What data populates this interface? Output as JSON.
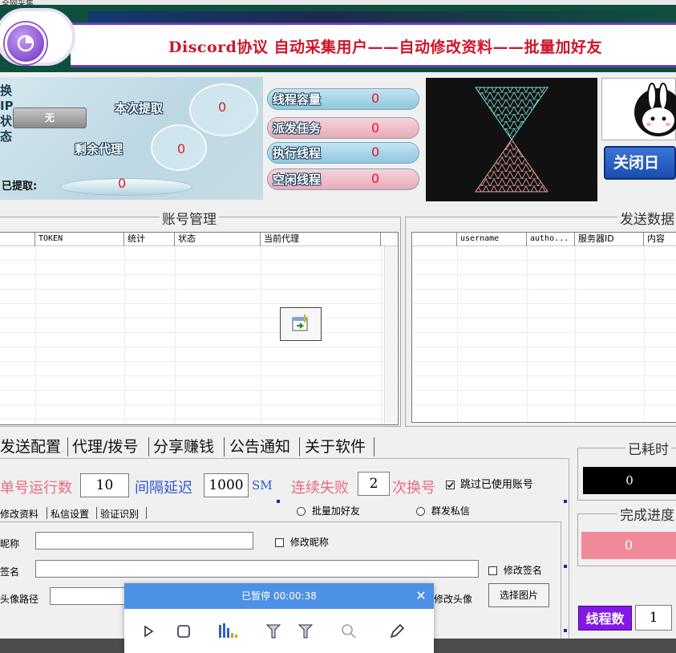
{
  "window": {
    "title": "全网采集"
  },
  "banner": {
    "title": "Discord协议  自动采集用户——自动修改资料——批量加好友"
  },
  "status": {
    "side_label": "换IP状态",
    "no_ip": "无",
    "this_fetch_label": "本次提取",
    "this_fetch_value": "0",
    "remaining_label": "剩余代理",
    "remaining_value": "0",
    "fetched_label": "已提取:",
    "fetched_value": "0"
  },
  "threads": [
    {
      "label": "线程容量",
      "value": "0",
      "color": "blue"
    },
    {
      "label": "派发任务",
      "value": "0",
      "color": "pink"
    },
    {
      "label": "执行线程",
      "value": "0",
      "color": "blue"
    },
    {
      "label": "空闲线程",
      "value": "0",
      "color": "pink"
    }
  ],
  "close_button": "关闭日",
  "account_group": {
    "title": "账号管理",
    "columns": [
      "",
      "TOKEN",
      "统计",
      "状态",
      "当前代理"
    ]
  },
  "send_group": {
    "title": "发送数据",
    "columns": [
      "",
      "username",
      "autho...",
      "服务器ID",
      "内容"
    ]
  },
  "main_tabs": [
    "发送配置",
    "代理/拨号",
    "分享赚钱",
    "公告通知",
    "关于软件"
  ],
  "config": {
    "single_run_label": "单号运行数",
    "single_run_value": "10",
    "interval_label": "间隔延迟",
    "interval_value": "1000",
    "interval_unit": "SM",
    "fail_label": "连续失败",
    "fail_value": "2",
    "switch_label": "次换号",
    "skip_used_label": "跳过已使用账号",
    "skip_used_checked": true,
    "radio_add_friend": "批量加好友",
    "radio_mass_dm": "群发私信"
  },
  "sub_tabs": [
    "修改资料",
    "私信设置",
    "验证识别"
  ],
  "profile": {
    "nickname_label": "昵称",
    "nickname_check": "修改昵称",
    "signature_label": "签名",
    "signature_check": "修改签名",
    "avatar_label": "头像路径",
    "avatar_check": "修改头像",
    "choose_image": "选择图片"
  },
  "right_panel": {
    "elapsed_title": "已耗时",
    "elapsed_value": "0",
    "progress_title": "完成进度",
    "progress_value": "0",
    "thread_count_label": "线程数",
    "thread_count_value": "1"
  },
  "recorder": {
    "status": "已暂停 00:00:38",
    "close": "✕",
    "icons": [
      "play-icon",
      "stop-icon",
      "chart-icon",
      "filter-icon",
      "filter-alt-icon",
      "zoom-icon",
      "pen-icon"
    ]
  },
  "colors": {
    "banner_bg": "#0f4f3e",
    "title_red": "#d0142a",
    "recorder_blue": "#4d91e6",
    "badge_purple": "#8317e6"
  }
}
